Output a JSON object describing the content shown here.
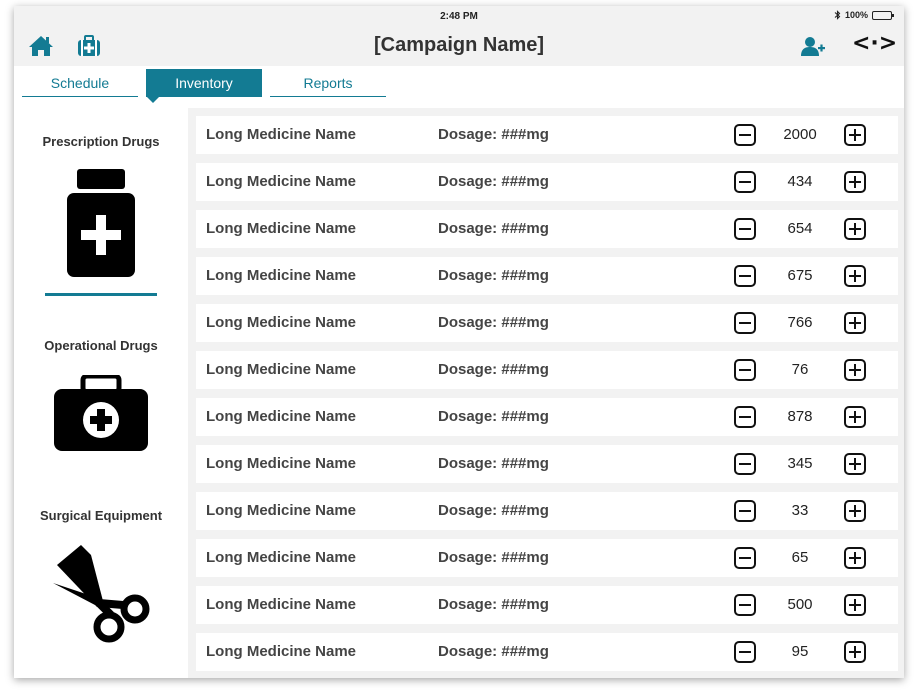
{
  "status_bar": {
    "time": "2:48 PM",
    "battery": "100%",
    "bluetooth_icon": "bluetooth-icon"
  },
  "header": {
    "title": "[Campaign Name]",
    "nav_symbol": "<·>"
  },
  "tabs": [
    {
      "label": "Schedule",
      "active": false
    },
    {
      "label": "Inventory",
      "active": true
    },
    {
      "label": "Reports",
      "active": false
    }
  ],
  "categories": [
    {
      "label": "Prescription Drugs",
      "icon": "pill-bottle-icon",
      "selected": true
    },
    {
      "label": "Operational Drugs",
      "icon": "medical-kit-icon",
      "selected": false
    },
    {
      "label": "Surgical Equipment",
      "icon": "scissors-icon",
      "selected": false
    }
  ],
  "items": [
    {
      "name": "Long Medicine Name",
      "dosage": "Dosage: ###mg",
      "quantity": "2000"
    },
    {
      "name": "Long Medicine Name",
      "dosage": "Dosage: ###mg",
      "quantity": "434"
    },
    {
      "name": "Long Medicine Name",
      "dosage": "Dosage: ###mg",
      "quantity": "654"
    },
    {
      "name": "Long Medicine Name",
      "dosage": "Dosage: ###mg",
      "quantity": "675"
    },
    {
      "name": "Long Medicine Name",
      "dosage": "Dosage: ###mg",
      "quantity": "766"
    },
    {
      "name": "Long Medicine Name",
      "dosage": "Dosage: ###mg",
      "quantity": "76"
    },
    {
      "name": "Long Medicine Name",
      "dosage": "Dosage: ###mg",
      "quantity": "878"
    },
    {
      "name": "Long Medicine Name",
      "dosage": "Dosage: ###mg",
      "quantity": "345"
    },
    {
      "name": "Long Medicine Name",
      "dosage": "Dosage: ###mg",
      "quantity": "33"
    },
    {
      "name": "Long Medicine Name",
      "dosage": "Dosage: ###mg",
      "quantity": "65"
    },
    {
      "name": "Long Medicine Name",
      "dosage": "Dosage: ###mg",
      "quantity": "500"
    },
    {
      "name": "Long Medicine Name",
      "dosage": "Dosage: ###mg",
      "quantity": "95"
    }
  ],
  "colors": {
    "accent": "#137b93",
    "background": "#f2f2f2",
    "text": "#333333"
  }
}
